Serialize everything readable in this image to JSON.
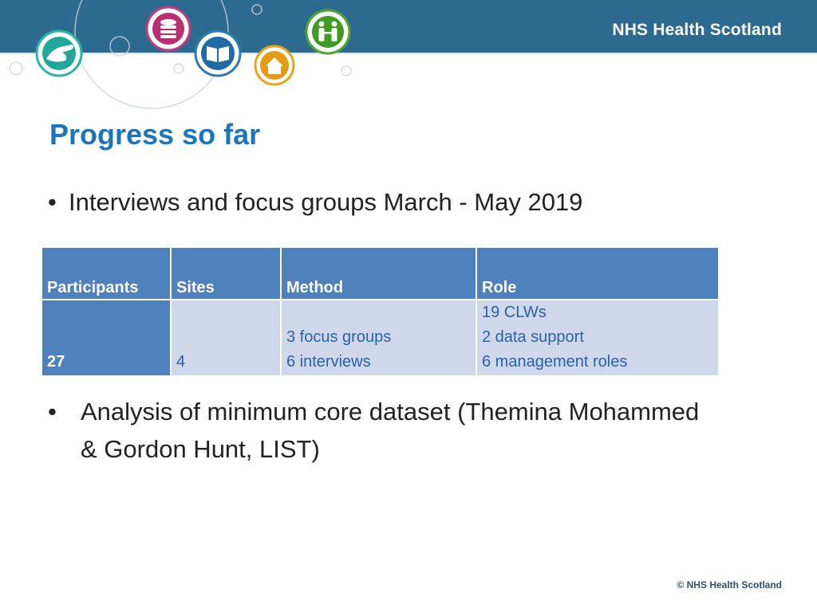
{
  "header": {
    "brand": "NHS Health Scotland",
    "icons": [
      "hands-icon",
      "coins-icon",
      "book-icon",
      "house-icon",
      "family-icon"
    ]
  },
  "slide": {
    "title": "Progress so far",
    "bullets": [
      "Interviews and focus groups March - May 2019",
      "Analysis of minimum core dataset (Themina Mohammed & Gordon Hunt, LIST)"
    ]
  },
  "table": {
    "headers": [
      "Participants",
      "Sites",
      "Method",
      "Role"
    ],
    "row": {
      "participants": "27",
      "sites": "4",
      "method": [
        "3 focus groups",
        "6 interviews"
      ],
      "role": [
        "19 CLWs",
        "2 data support",
        "6 management roles"
      ]
    }
  },
  "footer": {
    "copyright": "© NHS Health Scotland"
  },
  "colors": {
    "banner": "#2d6a8f",
    "title": "#1c75bc",
    "table_header": "#4f81bd",
    "table_cell": "#cfd8ea"
  }
}
